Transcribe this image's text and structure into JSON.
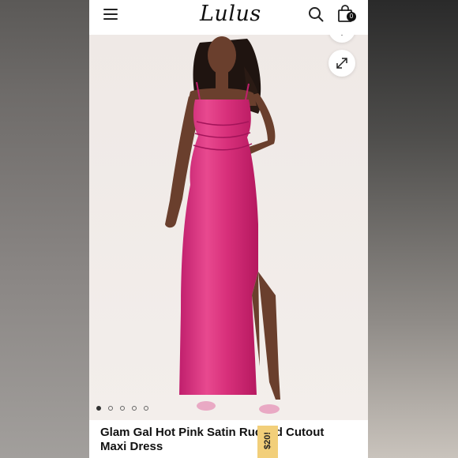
{
  "header": {
    "logo_text": "Lulus",
    "cart_count": "0",
    "icons": [
      "menu-icon",
      "search-icon",
      "shopping-bag-icon"
    ]
  },
  "gallery": {
    "image_subject": "model in hot pink satin maxi dress",
    "slide_count": 5,
    "active_slide": 1,
    "controls": [
      "heart-icon",
      "expand-icon"
    ]
  },
  "product": {
    "name": "Glam Gal Hot Pink Satin Ruched Cutout Maxi Dress"
  },
  "overlay": {
    "price_label": "$20!",
    "price_color": "#f2cf7a"
  }
}
